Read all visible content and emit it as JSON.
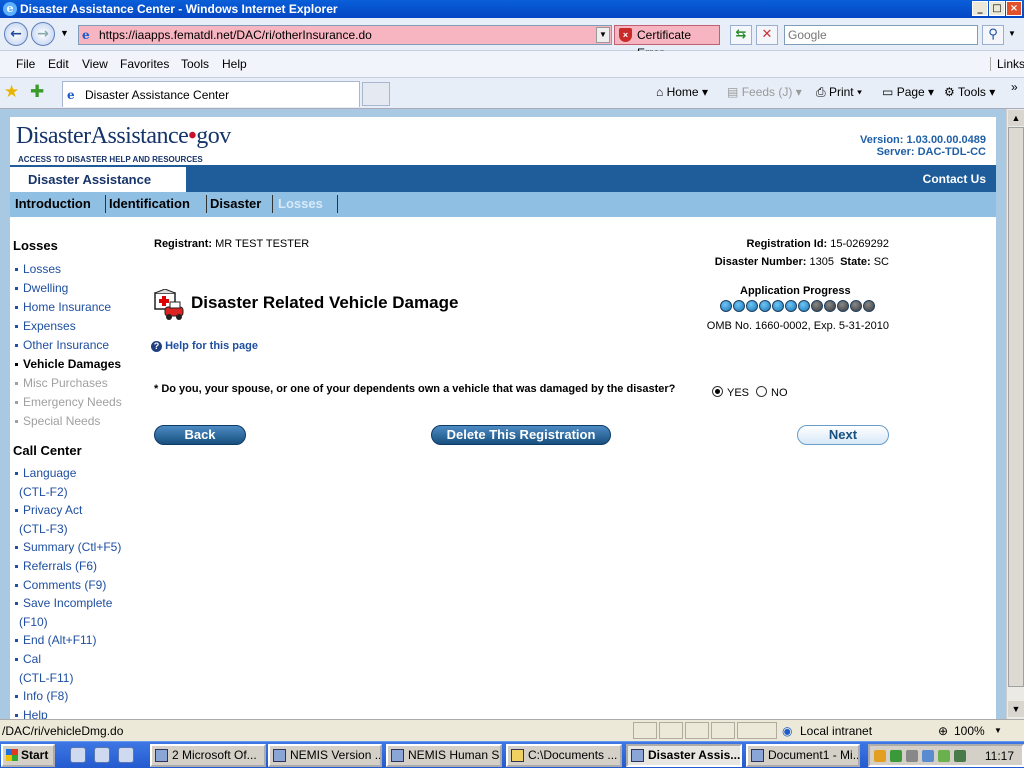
{
  "window": {
    "title": "Disaster Assistance Center - Windows Internet Explorer",
    "controls": [
      "_",
      "□",
      "×"
    ]
  },
  "browser": {
    "url": "https://iaapps.fematdl.net/DAC/ri/otherInsurance.do",
    "cert_error": "Certificate Error",
    "search_placeholder": "Google",
    "menu": [
      "File",
      "Edit",
      "View",
      "Favorites",
      "Tools",
      "Help"
    ],
    "links": "Links",
    "tab_title": "Disaster Assistance Center",
    "commands": {
      "home": "Home",
      "feeds": "Feeds (J)",
      "print": "Print",
      "page": "Page",
      "tools": "Tools"
    }
  },
  "site": {
    "logo_main": "DisasterAssistance",
    "logo_dot": "•",
    "logo_gov": "gov",
    "logo_sub": "ACCESS TO DISASTER HELP AND RESOURCES",
    "version": "Version: 1.03.00.00.0489",
    "server": "Server: DAC-TDL-CC",
    "nav_title": "Disaster Assistance",
    "contact": "Contact Us",
    "tabs": [
      "Introduction",
      "Identification",
      "Disaster",
      "Losses"
    ]
  },
  "sidebar": {
    "losses_heading": "Losses",
    "losses_items": [
      {
        "label": "Losses",
        "state": "link"
      },
      {
        "label": "Dwelling",
        "state": "link"
      },
      {
        "label": "Home Insurance",
        "state": "link"
      },
      {
        "label": "Expenses",
        "state": "link"
      },
      {
        "label": "Other Insurance",
        "state": "link"
      },
      {
        "label": "Vehicle Damages",
        "state": "current"
      },
      {
        "label": "Misc Purchases",
        "state": "disabled"
      },
      {
        "label": "Emergency Needs",
        "state": "disabled"
      },
      {
        "label": "Special Needs",
        "state": "disabled"
      }
    ],
    "call_heading": "Call Center",
    "call_items": [
      {
        "l1": "Language",
        "l2": "(CTL-F2)"
      },
      {
        "l1": "Privacy Act",
        "l2": "(CTL-F3)"
      },
      {
        "l1": "Summary (Ctl+F5)"
      },
      {
        "l1": "Referrals (F6)"
      },
      {
        "l1": "Comments (F9)"
      },
      {
        "l1": "Save Incomplete",
        "l2": "(F10)"
      },
      {
        "l1": "End (Alt+F11)"
      },
      {
        "l1": "Cal",
        "l2": "(CTL-F11)"
      },
      {
        "l1": "Info (F8)"
      },
      {
        "l1": "Help"
      }
    ]
  },
  "main": {
    "registrant_label": "Registrant:",
    "registrant": "MR TEST TESTER",
    "registration_label": "Registration Id:",
    "registration_id": "15-0269292",
    "disaster_label": "Disaster Number:",
    "disaster_number": "1305",
    "state_label": "State:",
    "state": "SC",
    "heading": "Disaster Related Vehicle Damage",
    "progress_label": "Application Progress",
    "progress_complete": 7,
    "progress_total": 12,
    "omb": "OMB No. 1660-0002, Exp. 5-31-2010",
    "help_link": "Help for this page",
    "question": "* Do you, your spouse, or one of your dependents own a vehicle that was damaged by the disaster?",
    "yes": "YES",
    "no": "NO",
    "selected": "YES",
    "back": "Back",
    "delete": "Delete This Registration",
    "next": "Next"
  },
  "statusbar": {
    "url": "/DAC/ri/vehicleDmg.do",
    "zone": "Local intranet",
    "zoom": "100%"
  },
  "taskbar": {
    "start": "Start",
    "tasks": [
      "2 Microsoft Of...",
      "NEMIS Version ...",
      "NEMIS Human S...",
      "C:\\Documents ...",
      "Disaster Assis...",
      "Document1 - Mi..."
    ],
    "clock": "11:17"
  }
}
